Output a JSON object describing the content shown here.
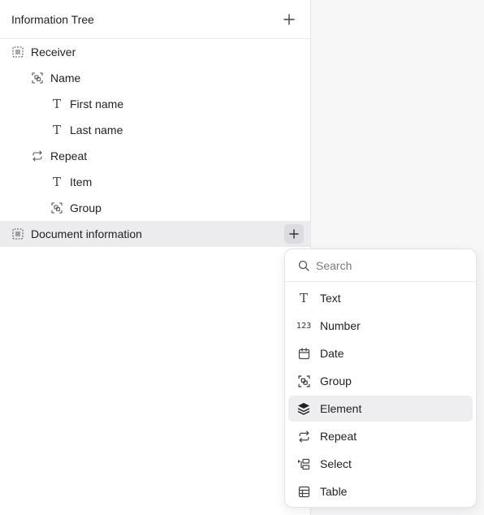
{
  "panel": {
    "title": "Information Tree"
  },
  "tree": [
    {
      "label": "Receiver",
      "icon": "element-icon"
    },
    {
      "label": "Name",
      "icon": "group-icon"
    },
    {
      "label": "First name",
      "icon": "text-icon"
    },
    {
      "label": "Last name",
      "icon": "text-icon"
    },
    {
      "label": "Repeat",
      "icon": "repeat-icon"
    },
    {
      "label": "Item",
      "icon": "text-icon"
    },
    {
      "label": "Group",
      "icon": "group-icon"
    },
    {
      "label": "Document information",
      "icon": "element-icon",
      "selected": true
    }
  ],
  "menu": {
    "search_placeholder": "Search",
    "items": [
      {
        "label": "Text",
        "icon": "text-icon"
      },
      {
        "label": "Number",
        "icon": "number-icon",
        "icon_text": "123"
      },
      {
        "label": "Date",
        "icon": "calendar-icon"
      },
      {
        "label": "Group",
        "icon": "group-icon"
      },
      {
        "label": "Element",
        "icon": "layers-icon",
        "highlighted": true
      },
      {
        "label": "Repeat",
        "icon": "repeat-icon"
      },
      {
        "label": "Select",
        "icon": "select-icon"
      },
      {
        "label": "Table",
        "icon": "table-icon"
      }
    ]
  },
  "colors": {
    "selected_row": "#ececee",
    "menu_hover": "#eeeef0",
    "border": "#e6e6e9"
  }
}
